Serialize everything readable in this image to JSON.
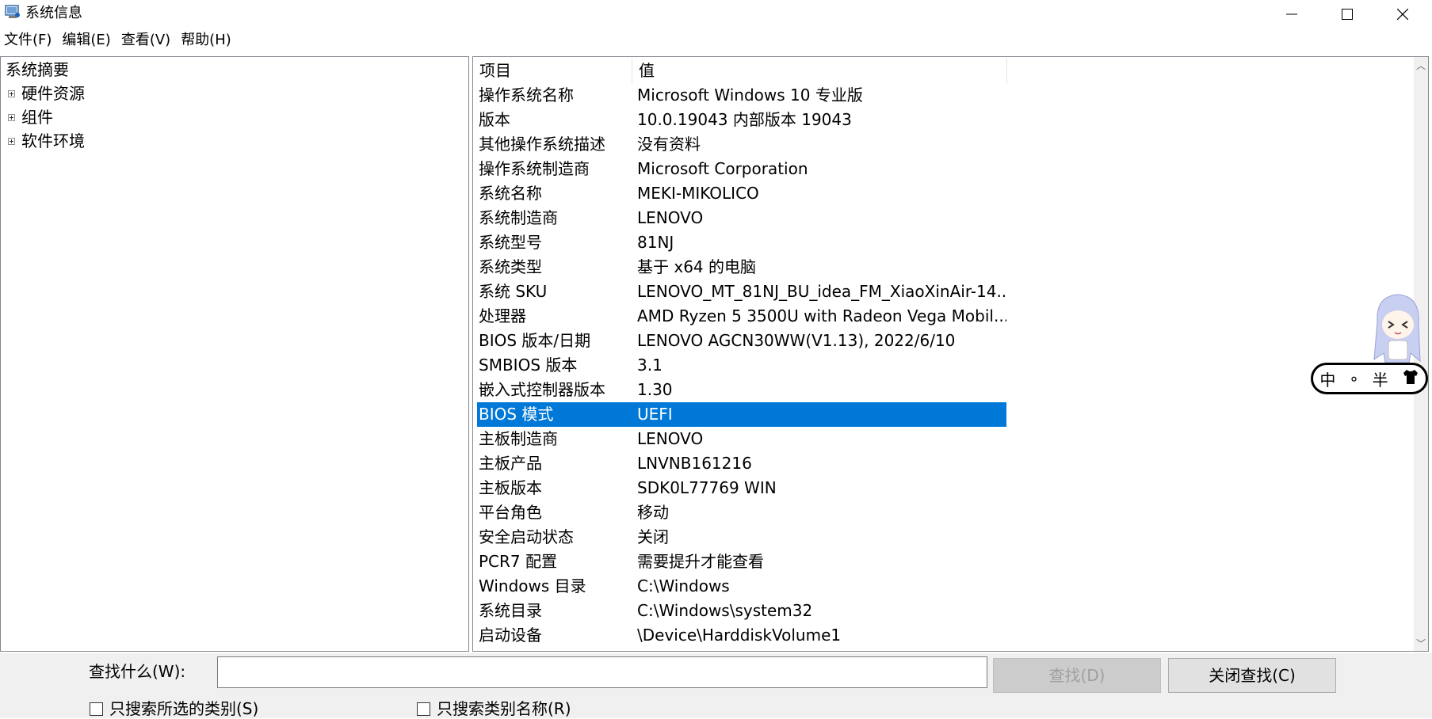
{
  "window": {
    "title": "系统信息"
  },
  "menu": [
    "文件(F)",
    "编辑(E)",
    "查看(V)",
    "帮助(H)"
  ],
  "tree": {
    "root": "系统摘要",
    "children": [
      "硬件资源",
      "组件",
      "软件环境"
    ]
  },
  "list": {
    "headers": {
      "item": "项目",
      "value": "值"
    },
    "rows": [
      {
        "k": "操作系统名称",
        "v": "Microsoft Windows 10 专业版"
      },
      {
        "k": "版本",
        "v": "10.0.19043 内部版本 19043"
      },
      {
        "k": "其他操作系统描述",
        "v": "没有资料"
      },
      {
        "k": "操作系统制造商",
        "v": "Microsoft Corporation"
      },
      {
        "k": "系统名称",
        "v": "MEKI-MIKOLICO"
      },
      {
        "k": "系统制造商",
        "v": "LENOVO"
      },
      {
        "k": "系统型号",
        "v": "81NJ"
      },
      {
        "k": "系统类型",
        "v": "基于 x64 的电脑"
      },
      {
        "k": "系统 SKU",
        "v": "LENOVO_MT_81NJ_BU_idea_FM_XiaoXinAir-14..."
      },
      {
        "k": "处理器",
        "v": "AMD Ryzen 5 3500U with Radeon Vega Mobil..."
      },
      {
        "k": "BIOS 版本/日期",
        "v": "LENOVO AGCN30WW(V1.13), 2022/6/10"
      },
      {
        "k": "SMBIOS 版本",
        "v": "3.1"
      },
      {
        "k": "嵌入式控制器版本",
        "v": "1.30"
      },
      {
        "k": "BIOS 模式",
        "v": "UEFI"
      },
      {
        "k": "主板制造商",
        "v": "LENOVO"
      },
      {
        "k": "主板产品",
        "v": "LNVNB161216"
      },
      {
        "k": "主板版本",
        "v": "SDK0L77769 WIN"
      },
      {
        "k": "平台角色",
        "v": "移动"
      },
      {
        "k": "安全启动状态",
        "v": "关闭"
      },
      {
        "k": "PCR7 配置",
        "v": "需要提升才能查看"
      },
      {
        "k": "Windows 目录",
        "v": "C:\\Windows"
      },
      {
        "k": "系统目录",
        "v": "C:\\Windows\\system32"
      },
      {
        "k": "启动设备",
        "v": "\\Device\\HarddiskVolume1"
      }
    ],
    "selected_index": 13
  },
  "find": {
    "label": "查找什么(W):",
    "value": "",
    "find_button": "查找(D)",
    "close_button": "关闭查找(C)",
    "opt_selected_category": "只搜索所选的类别(S)",
    "opt_category_names": "只搜索类别名称(R)"
  },
  "ime": {
    "mode": "中",
    "punct": "∘",
    "width": "半"
  },
  "colors": {
    "selection": "#0078d7",
    "chrome": "#f0f0f0"
  }
}
